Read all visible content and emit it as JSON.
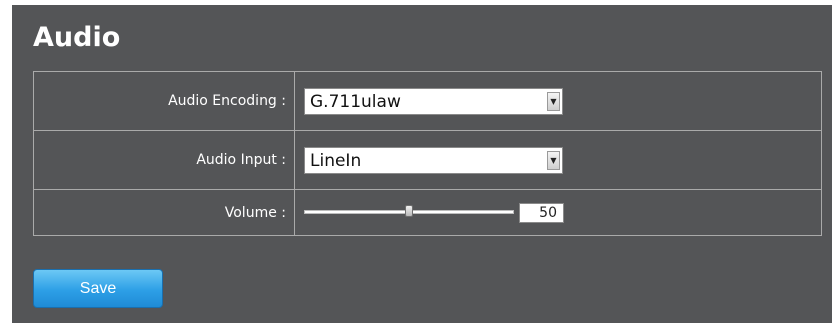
{
  "page": {
    "title": "Audio"
  },
  "settings": {
    "encoding": {
      "label": "Audio Encoding :",
      "value": "G.711ulaw"
    },
    "input": {
      "label": "Audio Input :",
      "value": "LineIn"
    },
    "volume": {
      "label": "Volume :",
      "value": "50",
      "level": 0.5
    }
  },
  "actions": {
    "save_label": "Save"
  },
  "icons": {
    "dropdown": "chevron-down-icon"
  },
  "colors": {
    "panel_background": "#545557",
    "button_accent": "#2d9fe6"
  }
}
